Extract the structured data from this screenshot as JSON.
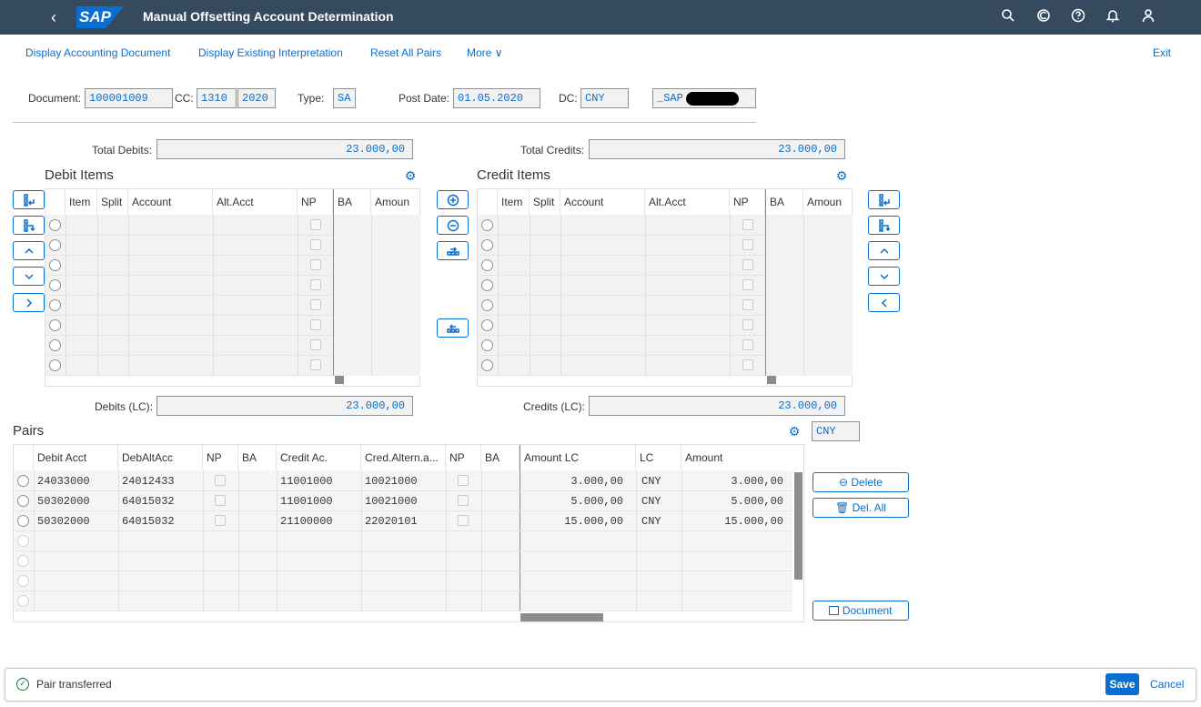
{
  "shell": {
    "title": "Manual Offsetting Account Determination",
    "logo": "SAP",
    "icons": [
      "search-icon",
      "copilot-icon",
      "help-icon",
      "notification-icon",
      "user-icon"
    ]
  },
  "toolbar": {
    "items": [
      "Display Accounting Document",
      "Display Existing Interpretation",
      "Reset All Pairs",
      "More"
    ],
    "exit": "Exit"
  },
  "header": {
    "document_label": "Document:",
    "document": "100001009",
    "cc_label": "CC:",
    "cc": "1310",
    "year": "2020",
    "type_label": "Type:",
    "type": "SA",
    "postdate_label": "Post Date:",
    "postdate": "01.05.2020",
    "dc_label": "DC:",
    "dc": "CNY",
    "user": "_SAP"
  },
  "debits": {
    "total_label": "Total Debits:",
    "total": "23.000,00",
    "title": "Debit Items",
    "columns": [
      "Item",
      "Split",
      "Account",
      "Alt.Acct",
      "NP",
      "BA",
      "Amoun"
    ],
    "lc_label": "Debits (LC):",
    "lc": "23.000,00"
  },
  "credits": {
    "total_label": "Total Credits:",
    "total": "23.000,00",
    "title": "Credit Items",
    "columns": [
      "Item",
      "Split",
      "Account",
      "Alt.Acct",
      "NP",
      "BA",
      "Amoun"
    ],
    "lc_label": "Credits (LC):",
    "lc": "23.000,00"
  },
  "pairs": {
    "title": "Pairs",
    "currency": "CNY",
    "columns": [
      "Debit Acct",
      "DebAltAcc",
      "NP",
      "BA",
      "Credit Ac.",
      "Cred.Altern.a...",
      "NP",
      "BA",
      "Amount LC",
      "LC",
      "Amount"
    ],
    "rows": [
      {
        "debit_acct": "24033000",
        "deb_alt": "24012433",
        "credit_ac": "11001000",
        "cred_alt": "10021000",
        "amount_lc": "3.000,00",
        "lc": "CNY",
        "amount": "3.000,00"
      },
      {
        "debit_acct": "50302000",
        "deb_alt": "64015032",
        "credit_ac": "11001000",
        "cred_alt": "10021000",
        "amount_lc": "5.000,00",
        "lc": "CNY",
        "amount": "5.000,00"
      },
      {
        "debit_acct": "50302000",
        "deb_alt": "64015032",
        "credit_ac": "21100000",
        "cred_alt": "22020101",
        "amount_lc": "15.000,00",
        "lc": "CNY",
        "amount": "15.000,00"
      }
    ],
    "buttons": {
      "delete": "Delete",
      "del_all": "Del. All",
      "document": "Document"
    }
  },
  "footer": {
    "message": "Pair transferred",
    "save": "Save",
    "cancel": "Cancel"
  },
  "colors": {
    "shell": "#354a5f",
    "accent": "#0a6ed1",
    "success": "#107e3e"
  }
}
